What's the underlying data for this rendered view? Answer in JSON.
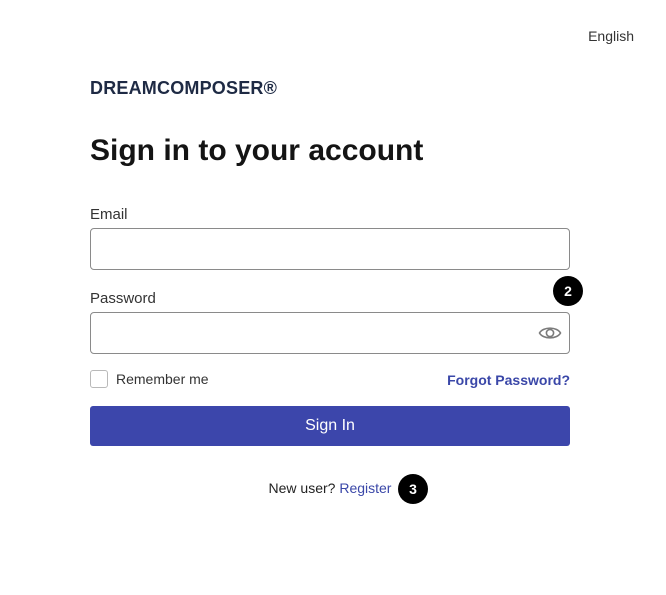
{
  "language": {
    "label": "English"
  },
  "brand": {
    "name": "DREAMCOMPOSER®"
  },
  "page": {
    "title": "Sign in to your account"
  },
  "form": {
    "email_label": "Email",
    "email_value": "",
    "password_label": "Password",
    "password_value": "",
    "remember_label": "Remember me",
    "remember_checked": false,
    "forgot_label": "Forgot Password?",
    "signin_label": "Sign In",
    "new_user_text": "New user?",
    "register_label": "Register"
  },
  "markers": [
    {
      "label": "2"
    },
    {
      "label": "3"
    }
  ],
  "icons": {
    "password_toggle": "eye-icon"
  },
  "colors": {
    "accent": "#3c46ab",
    "link": "#3a47a8"
  }
}
